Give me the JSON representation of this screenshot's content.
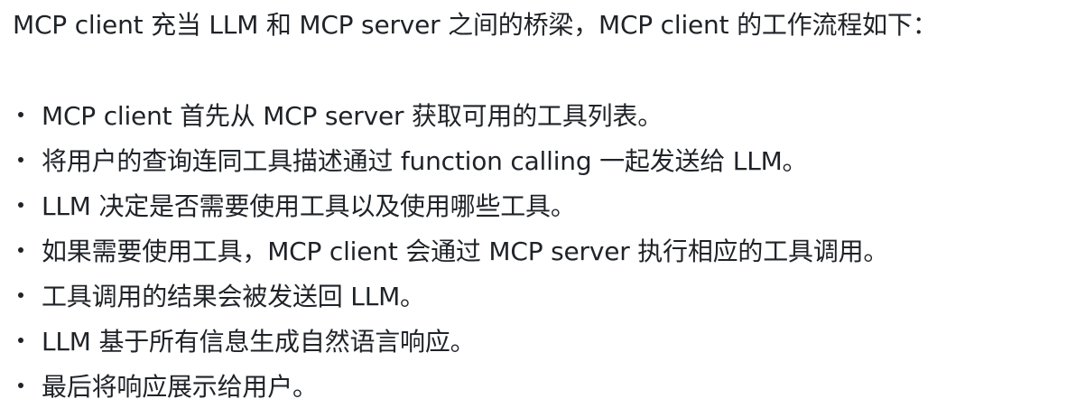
{
  "intro": "MCP client 充当 LLM 和 MCP server 之间的桥梁，MCP client 的工作流程如下：",
  "steps": [
    "MCP client 首先从 MCP server 获取可用的工具列表。",
    "将用户的查询连同工具描述通过 function calling 一起发送给 LLM。",
    "LLM 决定是否需要使用工具以及使用哪些工具。",
    "如果需要使用工具，MCP client 会通过 MCP server 执行相应的工具调用。",
    "工具调用的结果会被发送回 LLM。",
    "LLM 基于所有信息生成自然语言响应。",
    "最后将响应展示给用户。"
  ]
}
